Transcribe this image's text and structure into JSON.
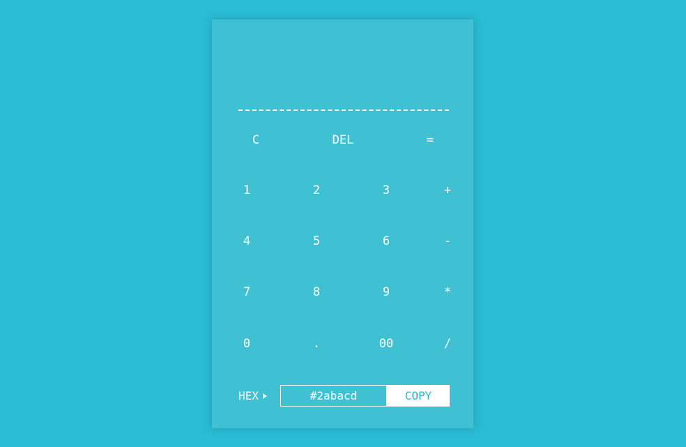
{
  "display": {
    "value": ""
  },
  "keys": {
    "clear": "C",
    "delete": "DEL",
    "equals": "=",
    "one": "1",
    "two": "2",
    "three": "3",
    "plus": "+",
    "four": "4",
    "five": "5",
    "six": "6",
    "minus": "-",
    "seven": "7",
    "eight": "8",
    "nine": "9",
    "multiply": "*",
    "zero": "0",
    "decimal": ".",
    "double_zero": "00",
    "divide": "/"
  },
  "color_picker": {
    "mode_label": "HEX",
    "mode_icon": "triangle-right-icon",
    "hex_value": "#2abacd",
    "copy_label": "COPY"
  },
  "colors": {
    "background": "#2abcd4",
    "panel": "#40c1d3",
    "text": "#ffffff",
    "copy_text": "#2abacd"
  }
}
